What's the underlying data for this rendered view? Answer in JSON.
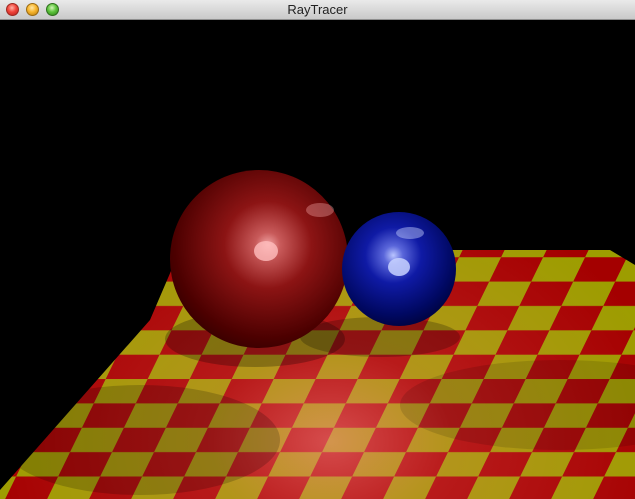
{
  "window": {
    "title": "RayTracer",
    "controls": {
      "close_icon": "close-icon",
      "minimize_icon": "minimize-icon",
      "zoom_icon": "zoom-icon"
    }
  },
  "scene": {
    "background_color": "#000000",
    "floor": {
      "pattern": "checkerboard",
      "color_a": "#b10000",
      "color_b": "#a8a800"
    },
    "spheres": [
      {
        "name": "red-sphere",
        "color": "#7a0000",
        "highlight": "#f0a0a0"
      },
      {
        "name": "blue-sphere",
        "color": "#000a8a",
        "highlight": "#a9b6ff"
      }
    ]
  }
}
